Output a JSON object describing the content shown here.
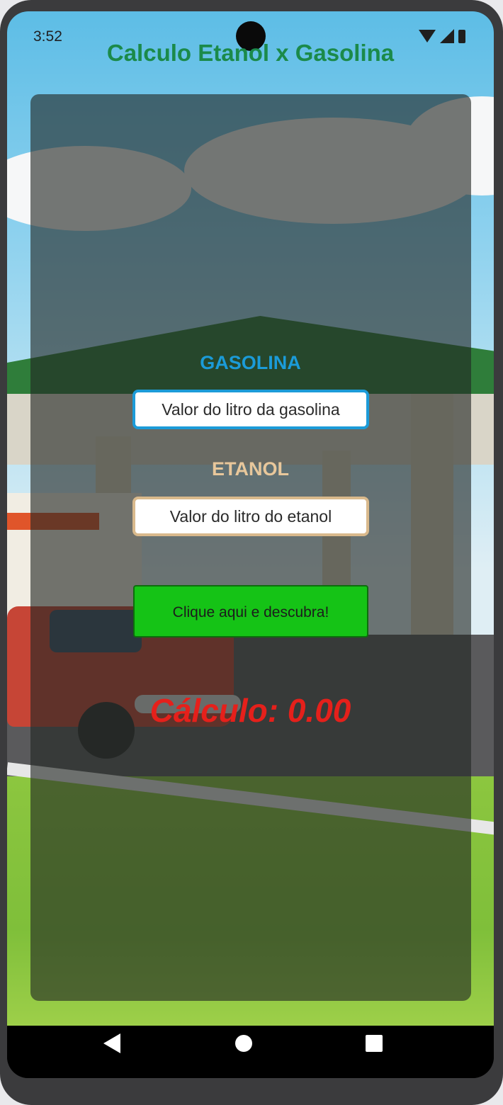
{
  "status_bar": {
    "time": "3:52"
  },
  "app": {
    "title": "Calculo Etanol x Gasolina"
  },
  "gasolina": {
    "label": "GASOLINA",
    "placeholder": "Valor do litro da gasolina",
    "value": ""
  },
  "etanol": {
    "label": "ETANOL",
    "placeholder": "Valor do litro do etanol",
    "value": ""
  },
  "action": {
    "button_label": "Clique aqui e descubra!"
  },
  "result": {
    "text": "Cálculo: 0.00"
  },
  "icons": {
    "wifi": "wifi-icon",
    "signal": "signal-icon",
    "battery": "battery-icon",
    "back": "back-icon",
    "home": "home-icon",
    "recents": "recents-icon"
  },
  "colors": {
    "title": "#1b8a4a",
    "gasolina": "#1b9bd8",
    "etanol": "#e8c79b",
    "button": "#15c316",
    "result": "#e5201b"
  }
}
